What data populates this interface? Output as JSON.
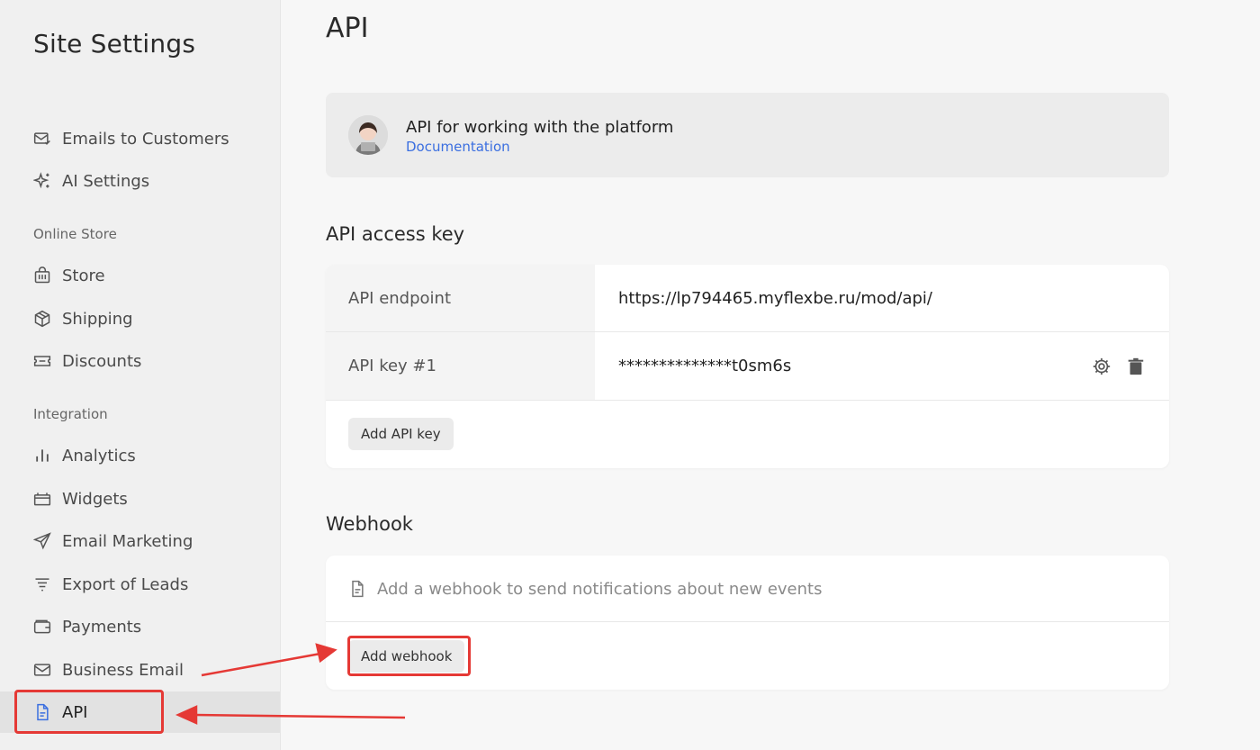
{
  "sidebar": {
    "title": "Site Settings",
    "items_top": [
      {
        "label": "Emails to Customers",
        "icon": "mail-check-icon"
      },
      {
        "label": "AI Settings",
        "icon": "sparkle-icon"
      }
    ],
    "section_store": "Online Store",
    "items_store": [
      {
        "label": "Store",
        "icon": "store-bag-icon"
      },
      {
        "label": "Shipping",
        "icon": "package-icon"
      },
      {
        "label": "Discounts",
        "icon": "ticket-icon"
      }
    ],
    "section_integration": "Integration",
    "items_integration": [
      {
        "label": "Analytics",
        "icon": "bar-chart-icon"
      },
      {
        "label": "Widgets",
        "icon": "widget-icon"
      },
      {
        "label": "Email Marketing",
        "icon": "send-icon"
      },
      {
        "label": "Export of Leads",
        "icon": "filter-icon"
      },
      {
        "label": "Payments",
        "icon": "wallet-icon"
      },
      {
        "label": "Business Email",
        "icon": "mail-icon"
      },
      {
        "label": "API",
        "icon": "document-icon",
        "active": true
      }
    ]
  },
  "main": {
    "title": "API",
    "info": {
      "title": "API for working with the platform",
      "link": "Documentation"
    },
    "access_key": {
      "title": "API access key",
      "rows": [
        {
          "label": "API endpoint",
          "value": "https://lp794465.myflexbe.ru/mod/api/"
        },
        {
          "label": "API key #1",
          "value": "**************t0sm6s"
        }
      ],
      "add_button": "Add API key"
    },
    "webhook": {
      "title": "Webhook",
      "hint": "Add a webhook to send notifications about new events",
      "add_button": "Add webhook"
    }
  },
  "colors": {
    "accent": "#3b6fe0",
    "annotation": "#e53935"
  }
}
